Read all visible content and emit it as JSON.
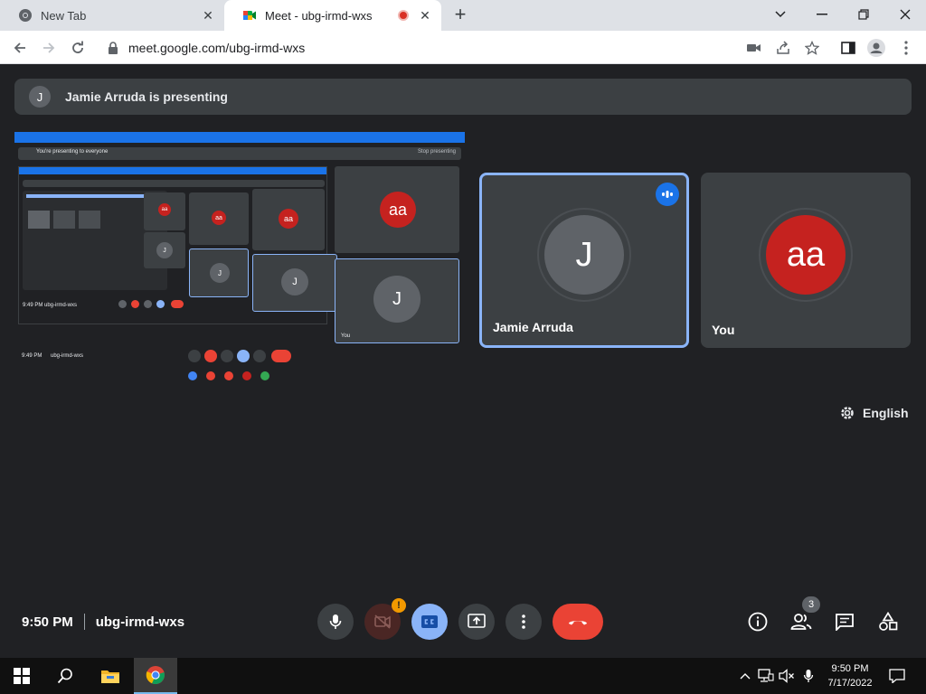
{
  "browser": {
    "tabs": [
      {
        "title": "New Tab",
        "icon": "chrome-icon"
      },
      {
        "title": "Meet - ubg-irmd-wxs",
        "icon": "meet-icon",
        "recording": true
      }
    ],
    "url": "meet.google.com/ubg-irmd-wxs"
  },
  "meet": {
    "presenting_banner": {
      "initial": "J",
      "text": "Jamie Arruda is presenting"
    },
    "shared_screen": {
      "banner_left": "You're presenting to everyone",
      "banner_right": "Stop presenting",
      "inner_time": "9:49 PM",
      "inner_code": "ubg-irmd-wxs",
      "deep_time": "9:49 PM",
      "deep_code": "ubg-irmd-wxs",
      "you_label": "You",
      "avatar_aa": "aa",
      "avatar_j": "J"
    },
    "participants": [
      {
        "name": "Jamie Arruda",
        "initial": "J",
        "color": "#5f6368",
        "speaking": true
      },
      {
        "name": "You",
        "initial": "aa",
        "color": "#c5221f",
        "speaking": false
      }
    ],
    "language": "English",
    "time": "9:50 PM",
    "meeting_code": "ubg-irmd-wxs",
    "people_count": "3",
    "camera_warning": "!",
    "colors": {
      "accent": "#8ab4f8",
      "leave": "#ea4335",
      "background": "#202124",
      "tile": "#3c4043"
    }
  },
  "taskbar": {
    "time": "9:50 PM",
    "date": "7/17/2022"
  }
}
